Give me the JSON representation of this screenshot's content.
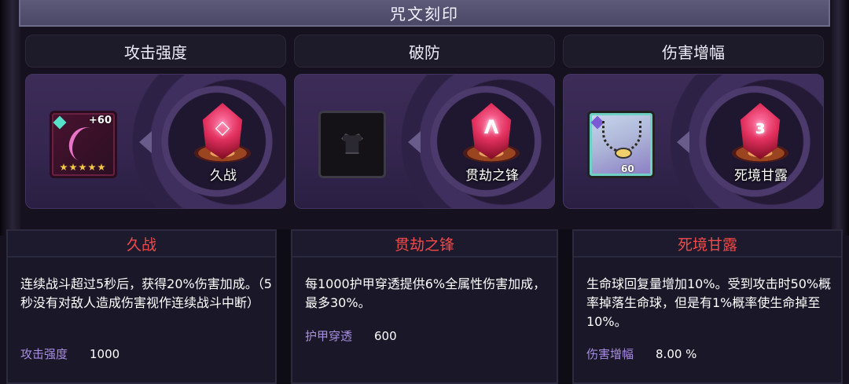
{
  "window": {
    "title": "咒文刻印"
  },
  "columns": [
    {
      "header": "攻击强度",
      "item": {
        "bonus": "+60",
        "stars": 5
      },
      "rune": {
        "name": "久战",
        "glyph": "◇"
      }
    },
    {
      "header": "破防",
      "item": null,
      "rune": {
        "name": "贯劫之锋",
        "glyph": "Λ"
      }
    },
    {
      "header": "伤害增幅",
      "item": {
        "level": "60"
      },
      "rune": {
        "name": "死境甘露",
        "glyph": "ɜ"
      }
    }
  ],
  "tooltips": [
    {
      "title": "久战",
      "description": "连续战斗超过5秒后，获得20%伤害加成。（5秒没有对敌人造成伤害视作连续战斗中断）",
      "stat_label": "攻击强度",
      "stat_value": "1000"
    },
    {
      "title": "贯劫之锋",
      "description": "每1000护甲穿透提供6%全属性伤害加成，最多30%。",
      "stat_label": "护甲穿透",
      "stat_value": "600"
    },
    {
      "title": "死境甘露",
      "description": "生命球回复量增加10%。受到攻击时50%概率掉落生命球，但是有1%概率使生命掉至10%。",
      "stat_label": "伤害增幅",
      "stat_value": "8.00 %"
    }
  ],
  "colors": {
    "tooltip_title": "#f04a4a",
    "stat_label": "#a88ee0",
    "rune_crystal": "#e2305e"
  }
}
